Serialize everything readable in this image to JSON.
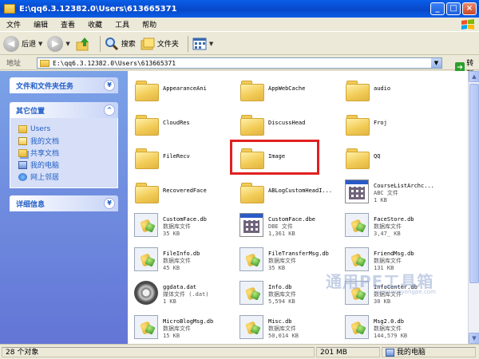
{
  "window": {
    "title": "E:\\qq6.3.12382.0\\Users\\613665371"
  },
  "menu": [
    "文件",
    "编辑",
    "查看",
    "收藏",
    "工具",
    "帮助"
  ],
  "toolbar": {
    "back_label": "后退",
    "search_label": "搜索",
    "folders_label": "文件夹"
  },
  "address": {
    "label": "地址",
    "value": "E:\\qq6.3.12382.0\\Users\\613665371",
    "go_label": "转到"
  },
  "tasks": {
    "file_tasks_title": "文件和文件夹任务",
    "other_places_title": "其它位置",
    "other_places": [
      {
        "label": "Users",
        "icon": "folder-icon"
      },
      {
        "label": "我的文档",
        "icon": "documents-icon"
      },
      {
        "label": "共享文档",
        "icon": "shared-folder-icon"
      },
      {
        "label": "我的电脑",
        "icon": "computer-icon"
      },
      {
        "label": "网上邻居",
        "icon": "network-icon"
      }
    ],
    "details_title": "详细信息"
  },
  "files": [
    {
      "name": "AppearanceAni",
      "type": "folder"
    },
    {
      "name": "AppWebCache",
      "type": "folder"
    },
    {
      "name": "audio",
      "type": "folder"
    },
    {
      "name": "CloudRes",
      "type": "folder"
    },
    {
      "name": "DiscussHead",
      "type": "folder"
    },
    {
      "name": "Froj",
      "type": "folder"
    },
    {
      "name": "FileRecv",
      "type": "folder"
    },
    {
      "name": "Image",
      "type": "folder"
    },
    {
      "name": "QQ",
      "type": "folder"
    },
    {
      "name": "RecoveredFace",
      "type": "folder"
    },
    {
      "name": "ABLogCustomHeadI...",
      "type": "folder"
    },
    {
      "name": "CourseListArchc...",
      "type": "dhe",
      "sub1": "ABC 文件",
      "sub2": "1 KB"
    },
    {
      "name": "CustomFace.db",
      "type": "db",
      "sub1": "数据库文件",
      "sub2": "35 KB"
    },
    {
      "name": "CustomFace.dbe",
      "type": "dhe",
      "sub1": "DBE 文件",
      "sub2": "1,361 KB"
    },
    {
      "name": "FaceStore.db",
      "type": "db",
      "sub1": "数据库文件",
      "sub2": "3,47_ KB"
    },
    {
      "name": "FileInfo.db",
      "type": "db",
      "sub1": "数据库文件",
      "sub2": "45 KB"
    },
    {
      "name": "FileTransferMsg.db",
      "type": "db",
      "sub1": "数据库文件",
      "sub2": "35 KB"
    },
    {
      "name": "FriendMsg.db",
      "type": "db",
      "sub1": "数据库文件",
      "sub2": "131 KB"
    },
    {
      "name": "ggdata.dat",
      "type": "dat",
      "sub1": "媒体文件 (.dat)",
      "sub2": "1 KB"
    },
    {
      "name": "Info.db",
      "type": "db",
      "sub1": "数据库文件",
      "sub2": "5,594 KB"
    },
    {
      "name": "InfoCenter.db",
      "type": "db",
      "sub1": "数据库文件",
      "sub2": "30 KB"
    },
    {
      "name": "MicroBlogMsg.db",
      "type": "db",
      "sub1": "数据库文件",
      "sub2": "15 KB"
    },
    {
      "name": "Misc.db",
      "type": "db",
      "sub1": "数据库文件",
      "sub2": "50,014 KB"
    },
    {
      "name": "Msg2.0.db",
      "type": "db",
      "sub1": "数据库文件",
      "sub2": "144,579 KB"
    }
  ],
  "watermark": {
    "main": "通用PE工具箱",
    "sub": "www.tongyongpe.com"
  },
  "status": {
    "count": "28 个对象",
    "size": "201 MB",
    "location": "我的电脑"
  }
}
